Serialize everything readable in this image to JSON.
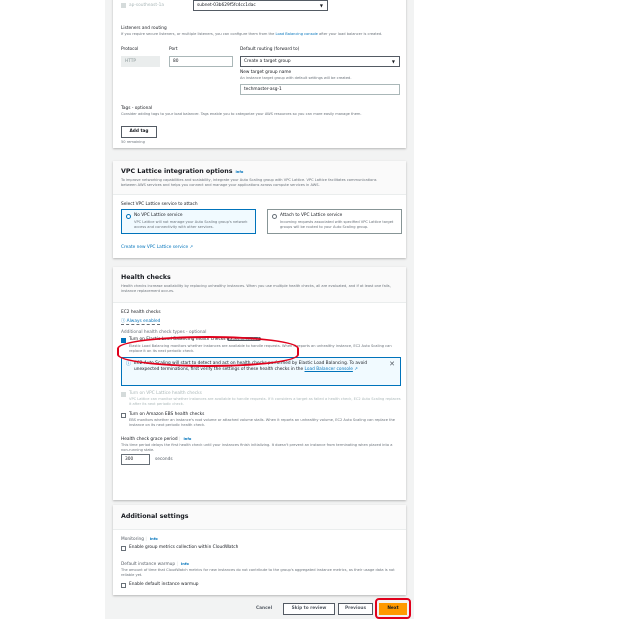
{
  "subnet": {
    "az_label": "ap-southeast-1a",
    "subnet_value": "subnet-03b629f5fc4cc1dac"
  },
  "listeners": {
    "title": "Listeners and routing",
    "desc_prefix": "If you require secure listeners, or multiple listeners, you can configure them from the ",
    "desc_link": "Load Balancing console",
    "desc_suffix": " after your load balancer is created.",
    "protocol_label": "Protocol",
    "protocol_value": "HTTP",
    "port_label": "Port",
    "port_value": "80",
    "routing_label": "Default routing (forward to)",
    "routing_value": "Create a target group",
    "tg_name_label": "New target group name",
    "tg_name_desc": "An instance target group with default settings will be created.",
    "tg_name_value": "techmaster-asg-1"
  },
  "tags": {
    "title": "Tags - optional",
    "desc": "Consider adding tags to your load balancer. Tags enable you to categorize your AWS resources so you can more easily manage them.",
    "add_label": "Add tag",
    "remaining": "50 remaining"
  },
  "lattice": {
    "title": "VPC Lattice integration options",
    "info": "Info",
    "desc": "To improve networking capabilities and scalability, integrate your Auto Scaling group with VPC Lattice. VPC Lattice facilitates communications between AWS services and helps you connect and manage your applications across compute services in AWS.",
    "select_label": "Select VPC Lattice service to attach",
    "options": [
      {
        "label": "No VPC Lattice service",
        "desc": "VPC Lattice will not manage your Auto Scaling group's network access and connectivity with other services.",
        "selected": true
      },
      {
        "label": "Attach to VPC Lattice service",
        "desc": "Incoming requests associated with specified VPC Lattice target groups will be routed to your Auto Scaling group.",
        "selected": false
      }
    ],
    "create_link": "Create new VPC Lattice service"
  },
  "health": {
    "title": "Health checks",
    "desc": "Health checks increase availability by replacing unhealthy instances. When you use multiple health checks, all are evaluated, and if at least one fails, instance replacement occurs.",
    "ec2_label": "EC2 health checks",
    "ec2_value": "Always enabled",
    "additional_label": "Additional health check types - optional",
    "elb": {
      "label": "Turn on Elastic Load Balancing health checks",
      "badge": "Recommended",
      "desc": "Elastic Load Balancing monitors whether instances are available to handle requests. When it reports an unhealthy instance, EC2 Auto Scaling can replace it on its next periodic check.",
      "checked": true
    },
    "alert_text": "EC2 Auto Scaling will start to detect and act on health checks performed by Elastic Load Balancing. To avoid unexpected terminations, first verify the settings of these health checks in the ",
    "alert_link": "Load Balancer console",
    "lattice_hc": {
      "label": "Turn on VPC Lattice health checks",
      "desc": "VPC Lattice can monitor whether instances are available to handle requests. If it considers a target as failed a health check, EC2 Auto Scaling replaces it after its next periodic check.",
      "checked": false
    },
    "ebs_hc": {
      "label": "Turn on Amazon EBS health checks",
      "desc": "EBS monitors whether an instance's root volume or attached volume stalls. When it reports an unhealthy volume, EC2 Auto Scaling can replace the instance on its next periodic health check.",
      "checked": false
    },
    "grace_label": "Health check grace period",
    "grace_info": "Info",
    "grace_desc": "This time period delays the first health check until your instances finish initializing. It doesn't prevent an instance from terminating when placed into a non-running state.",
    "grace_value": "300",
    "grace_unit": "seconds"
  },
  "additional": {
    "title": "Additional settings",
    "monitoring_label": "Monitoring",
    "monitoring_info": "Info",
    "monitoring_cb": "Enable group metrics collection within CloudWatch",
    "warmup_label": "Default instance warmup",
    "warmup_info": "Info",
    "warmup_desc": "The amount of time that CloudWatch metrics for new instances do not contribute to the group's aggregated instance metrics, as their usage data is not reliable yet.",
    "warmup_cb": "Enable default instance warmup"
  },
  "footer": {
    "cancel": "Cancel",
    "skip": "Skip to review",
    "previous": "Previous",
    "next": "Next"
  },
  "colors": {
    "accent": "#0073bb",
    "primary_button": "#ff9900",
    "annotation": "#e0001b"
  }
}
